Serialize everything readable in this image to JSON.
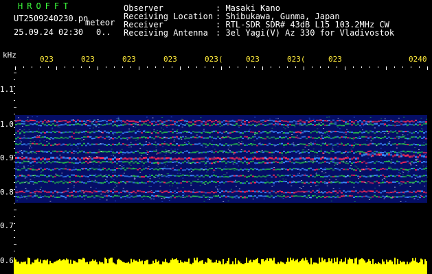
{
  "header": {
    "app_name": "HROFFT",
    "filename": "UT2509240230.pn",
    "tag": "meteor",
    "timestamp": "25.09.24 02:30",
    "count": "0.."
  },
  "info": {
    "rows": [
      {
        "label": "Observer",
        "value": ": Masaki Kano"
      },
      {
        "label": "Receiving Location",
        "value": ": Shibukawa, Gunma, Japan"
      },
      {
        "label": "Receiver",
        "value": ": RTL-SDR SDR# 43dB L15 103.2MHz CW"
      },
      {
        "label": "Receiving Antenna",
        "value": ": 3el Yagi(V) Az 330 for Vladivostok"
      }
    ]
  },
  "axis": {
    "unit": "kHz",
    "y_labels": [
      "1.1",
      "1.0",
      "0.9",
      "0.8",
      "0.7",
      "0.6"
    ],
    "x_labels": [
      "023",
      "023",
      "023",
      "023",
      "023(",
      "023",
      "023(",
      "023",
      "0240"
    ]
  },
  "colors": {
    "background": "#000000",
    "spectrum_low": "#0a1aa0",
    "spectrum_mid": "#27c34a",
    "spectrum_high": "#ff2a55",
    "level_bar": "#ffff00",
    "title_green": "#3cff3c"
  }
}
